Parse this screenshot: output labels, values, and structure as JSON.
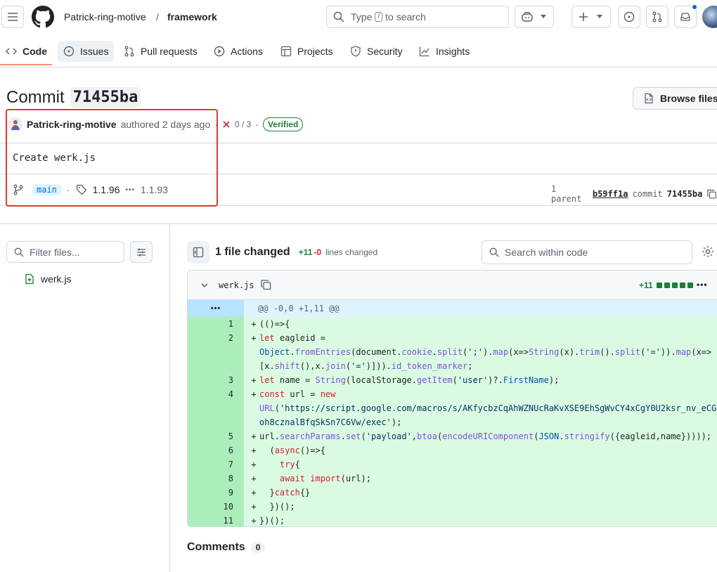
{
  "header": {
    "owner": "Patrick-ring-motive",
    "separator": "/",
    "repo": "framework",
    "search_pre": "Type",
    "search_key": "/",
    "search_post": "to search"
  },
  "tabs": [
    {
      "label": "Code",
      "icon": "code-icon"
    },
    {
      "label": "Issues",
      "icon": "issue-icon"
    },
    {
      "label": "Pull requests",
      "icon": "pull-request-icon"
    },
    {
      "label": "Actions",
      "icon": "play-icon"
    },
    {
      "label": "Projects",
      "icon": "table-icon"
    },
    {
      "label": "Security",
      "icon": "shield-icon"
    },
    {
      "label": "Insights",
      "icon": "graph-icon"
    }
  ],
  "commit": {
    "title_prefix": "Commit",
    "sha": "71455ba",
    "browse_label": "Browse files",
    "author": "Patrick-ring-motive",
    "authored_text": "authored 2 days ago",
    "dot": "·",
    "checks": "0 / 3",
    "verified": "Verified",
    "message": "Create werk.js",
    "branch": "main",
    "tag": "1.1.96",
    "ellipsis": "•••",
    "tag_more": "1.1.93",
    "parent_count": "1 parent",
    "parent_sha": "b59ff1a",
    "commit_label": "commit",
    "commit_sha": "71455ba"
  },
  "sidebar": {
    "filter_placeholder": "Filter files...",
    "files": [
      {
        "name": "werk.js"
      }
    ]
  },
  "diff": {
    "files_changed": "1 file changed",
    "additions": "+11",
    "deletions": "-0",
    "lines_changed": "lines changed",
    "search_placeholder": "Search within code",
    "file_name": "werk.js",
    "file_additions": "+11",
    "hunk_dots": "•••",
    "hunk_header": "@@ -0,0 +1,11 @@",
    "sign": "+",
    "line_numbers": [
      "1",
      "2",
      "3",
      "4",
      "5",
      "6",
      "7",
      "8",
      "9",
      "10",
      "11"
    ]
  },
  "comments": {
    "label": "Comments",
    "count": "0"
  },
  "colors": {
    "accent_underline": "#fd8c73",
    "added_line_bg": "#dafbe1",
    "added_gutter_bg": "#aceebb",
    "hunk_bg": "#ddf4ff",
    "verified_green": "#1a7f37",
    "highlight_box": "#dd3b2b"
  }
}
